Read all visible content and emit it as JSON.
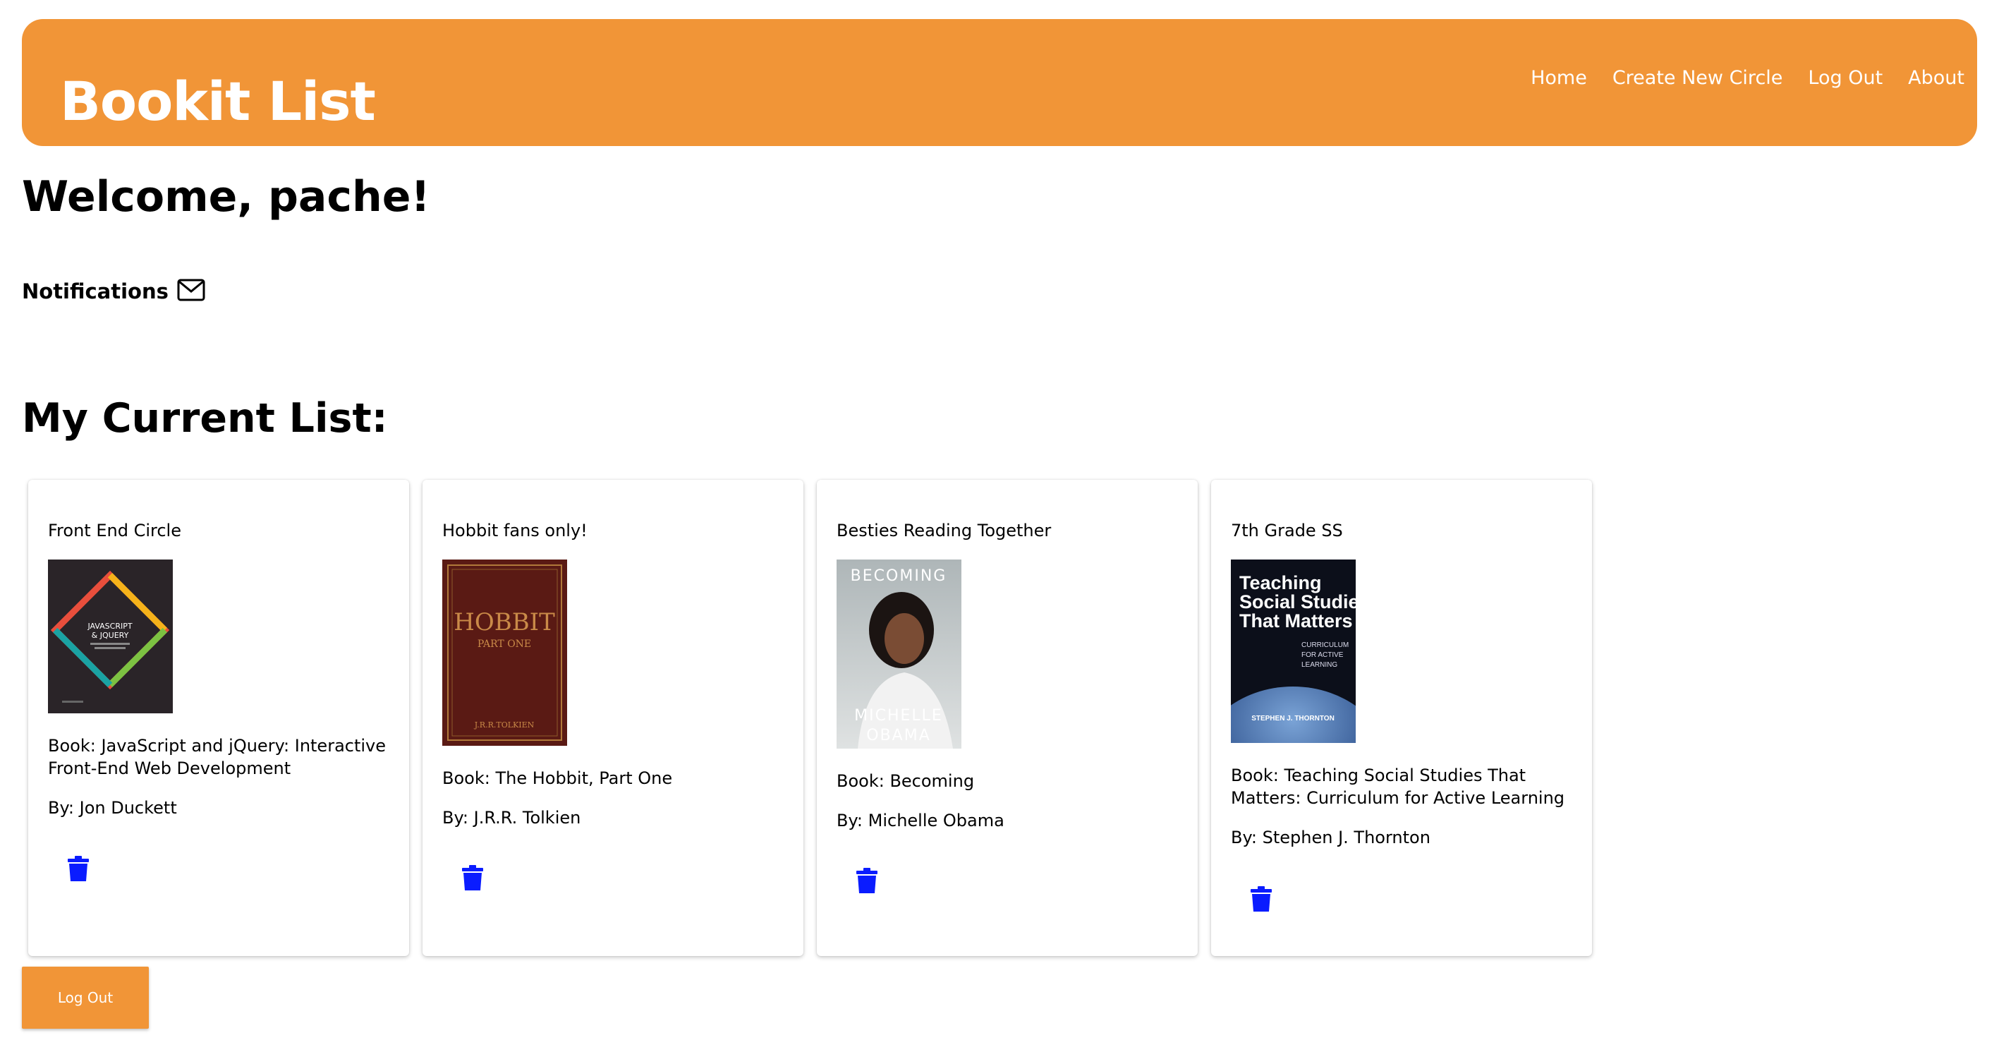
{
  "header": {
    "brand": "Bookit List",
    "nav": [
      "Home",
      "Create New Circle",
      "Log Out",
      "About"
    ]
  },
  "welcome": "Welcome, pache!",
  "notifications_label": "Notifications",
  "list_title": "My Current List:",
  "cards": [
    {
      "circle": "Front End Circle",
      "book": "Book: JavaScript and jQuery: Interactive Front-End Web Development",
      "author": "By: Jon Duckett",
      "cover_text": [
        "JAVASCRIPT",
        "& JQUERY"
      ]
    },
    {
      "circle": "Hobbit fans only!",
      "book": "Book: The Hobbit, Part One",
      "author": "By: J.R.R. Tolkien",
      "cover_text": [
        "HOBBIT",
        "PART ONE",
        "J.R.R.TOLKIEN"
      ]
    },
    {
      "circle": "Besties Reading Together",
      "book": "Book: Becoming",
      "author": "By: Michelle Obama",
      "cover_text": [
        "BECOMING",
        "MICHELLE",
        "OBAMA"
      ]
    },
    {
      "circle": "7th Grade SS",
      "book": "Book: Teaching Social Studies That Matters: Curriculum for Active Learning",
      "author": "By: Stephen J. Thornton",
      "cover_text": [
        "Teaching",
        "Social Studies",
        "That Matters",
        "CURRICULUM",
        "FOR ACTIVE",
        "LEARNING",
        "STEPHEN J. THORNTON"
      ]
    }
  ],
  "logout_button": "Log Out",
  "colors": {
    "accent": "#f19537",
    "trash": "#0a1cff"
  }
}
